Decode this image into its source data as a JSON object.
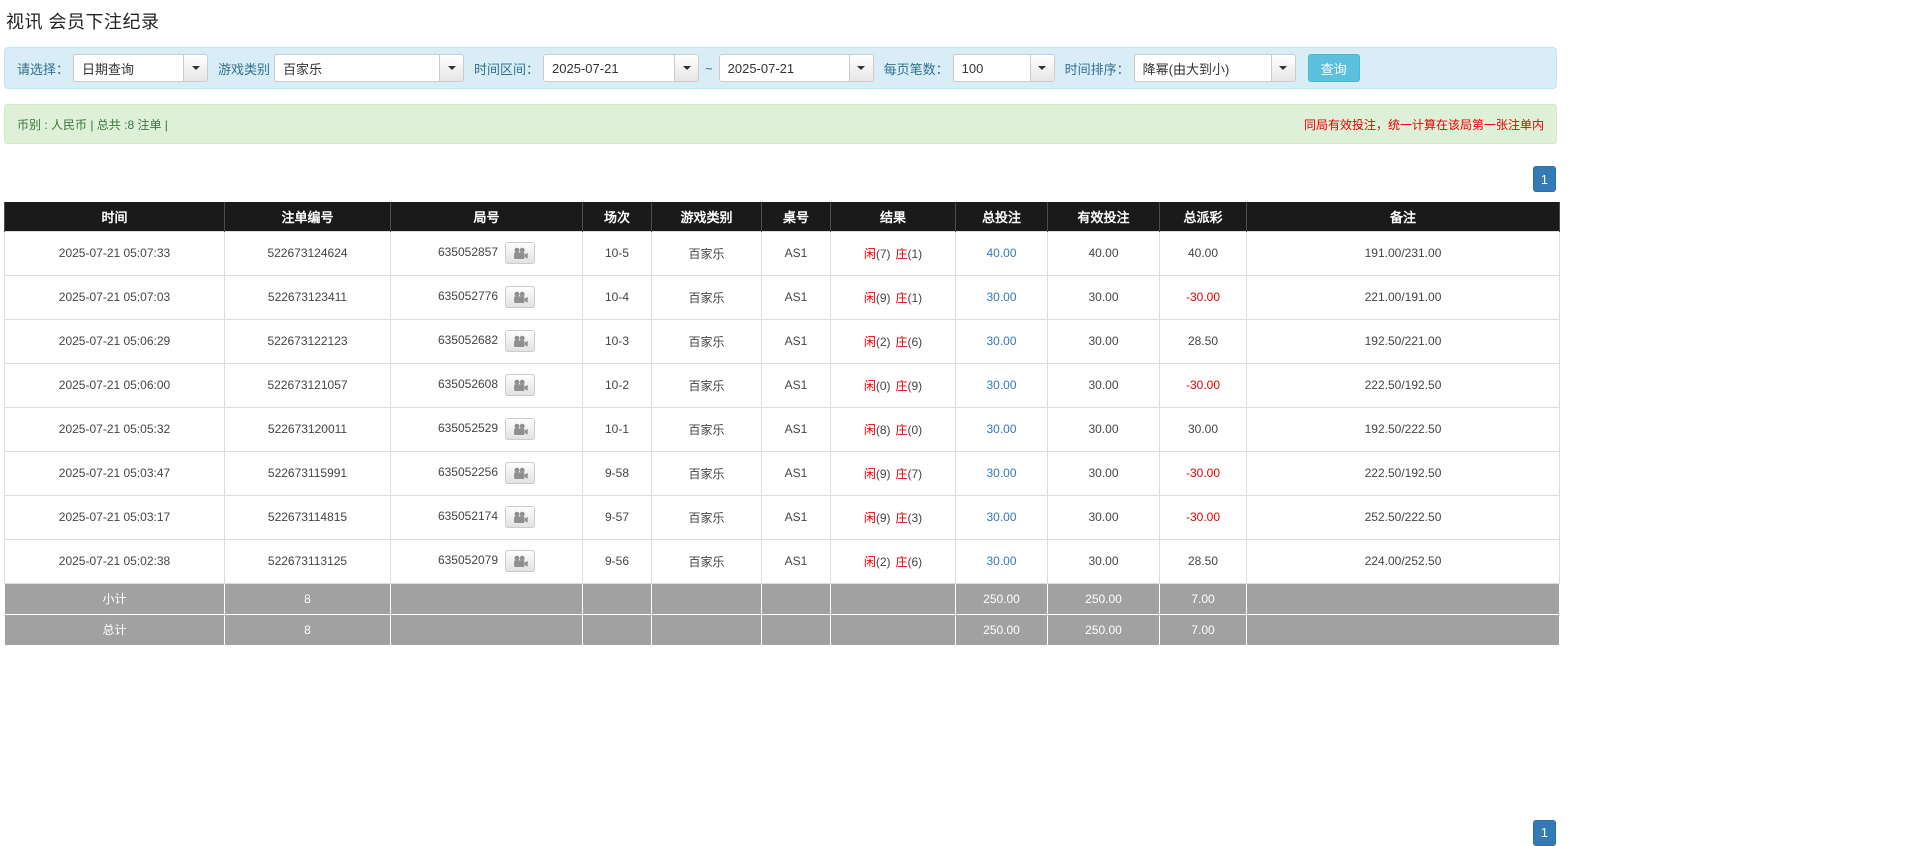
{
  "colors": {
    "accent_blue": "#337ab7",
    "red": "#e60000",
    "filter_bg": "#d9edf7",
    "filter_border": "#bce8f1",
    "filter_label": "#31708f",
    "btn_bg": "#5bc0de",
    "btn_border": "#46b8da",
    "summary_bg": "#dff0d8",
    "summary_border": "#d6e9c6",
    "summary_text": "#3c763d",
    "header_bg": "#1a1a1a",
    "footer_bg": "#a1a1a1"
  },
  "page": {
    "title": "视讯 会员下注纪录"
  },
  "filters": {
    "select_label": "请选择：",
    "select_value": "日期查询",
    "game_type_label": "游戏类别",
    "game_type_value": "百家乐",
    "range_label": "时间区间：",
    "date_from": "2025-07-21",
    "range_separator": "~",
    "date_to": "2025-07-21",
    "page_size_label": "每页笔数：",
    "page_size_value": "100",
    "sort_label": "时间排序：",
    "sort_value": "降幂(由大到小)",
    "search_button": "查询"
  },
  "summary": {
    "left": "币别 : 人民币 | 总共 :8 注单 |",
    "notice": "同局有效投注，统一计算在该局第一张注单内"
  },
  "pagination": {
    "current_page": "1"
  },
  "table": {
    "headers": [
      "时间",
      "注单编号",
      "局号",
      "场次",
      "游戏类别",
      "桌号",
      "结果",
      "总投注",
      "有效投注",
      "总派彩",
      "备注"
    ],
    "rows": [
      {
        "time": "2025-07-21 05:07:33",
        "bet_id": "522673124624",
        "round_id": "635052857",
        "session": "10-5",
        "game_type": "百家乐",
        "table_no": "AS1",
        "player_label": "闲",
        "player_score": "(7)",
        "banker_label": "庄",
        "banker_score": "(1)",
        "total_bet": "40.00",
        "valid_bet": "40.00",
        "payout": "40.00",
        "note": "191.00/231.00"
      },
      {
        "time": "2025-07-21 05:07:03",
        "bet_id": "522673123411",
        "round_id": "635052776",
        "session": "10-4",
        "game_type": "百家乐",
        "table_no": "AS1",
        "player_label": "闲",
        "player_score": "(9)",
        "banker_label": "庄",
        "banker_score": "(1)",
        "total_bet": "30.00",
        "valid_bet": "30.00",
        "payout": "-30.00",
        "note": "221.00/191.00"
      },
      {
        "time": "2025-07-21 05:06:29",
        "bet_id": "522673122123",
        "round_id": "635052682",
        "session": "10-3",
        "game_type": "百家乐",
        "table_no": "AS1",
        "player_label": "闲",
        "player_score": "(2)",
        "banker_label": "庄",
        "banker_score": "(6)",
        "total_bet": "30.00",
        "valid_bet": "30.00",
        "payout": "28.50",
        "note": "192.50/221.00"
      },
      {
        "time": "2025-07-21 05:06:00",
        "bet_id": "522673121057",
        "round_id": "635052608",
        "session": "10-2",
        "game_type": "百家乐",
        "table_no": "AS1",
        "player_label": "闲",
        "player_score": "(0)",
        "banker_label": "庄",
        "banker_score": "(9)",
        "total_bet": "30.00",
        "valid_bet": "30.00",
        "payout": "-30.00",
        "note": "222.50/192.50"
      },
      {
        "time": "2025-07-21 05:05:32",
        "bet_id": "522673120011",
        "round_id": "635052529",
        "session": "10-1",
        "game_type": "百家乐",
        "table_no": "AS1",
        "player_label": "闲",
        "player_score": "(8)",
        "banker_label": "庄",
        "banker_score": "(0)",
        "total_bet": "30.00",
        "valid_bet": "30.00",
        "payout": "30.00",
        "note": "192.50/222.50"
      },
      {
        "time": "2025-07-21 05:03:47",
        "bet_id": "522673115991",
        "round_id": "635052256",
        "session": "9-58",
        "game_type": "百家乐",
        "table_no": "AS1",
        "player_label": "闲",
        "player_score": "(9)",
        "banker_label": "庄",
        "banker_score": "(7)",
        "total_bet": "30.00",
        "valid_bet": "30.00",
        "payout": "-30.00",
        "note": "222.50/192.50"
      },
      {
        "time": "2025-07-21 05:03:17",
        "bet_id": "522673114815",
        "round_id": "635052174",
        "session": "9-57",
        "game_type": "百家乐",
        "table_no": "AS1",
        "player_label": "闲",
        "player_score": "(9)",
        "banker_label": "庄",
        "banker_score": "(3)",
        "total_bet": "30.00",
        "valid_bet": "30.00",
        "payout": "-30.00",
        "note": "252.50/222.50"
      },
      {
        "time": "2025-07-21 05:02:38",
        "bet_id": "522673113125",
        "round_id": "635052079",
        "session": "9-56",
        "game_type": "百家乐",
        "table_no": "AS1",
        "player_label": "闲",
        "player_score": "(2)",
        "banker_label": "庄",
        "banker_score": "(6)",
        "total_bet": "30.00",
        "valid_bet": "30.00",
        "payout": "28.50",
        "note": "224.00/252.50"
      }
    ],
    "subtotal": {
      "label": "小计",
      "count": "8",
      "total_bet": "250.00",
      "valid_bet": "250.00",
      "payout": "7.00"
    },
    "total": {
      "label": "总计",
      "count": "8",
      "total_bet": "250.00",
      "valid_bet": "250.00",
      "payout": "7.00"
    }
  }
}
